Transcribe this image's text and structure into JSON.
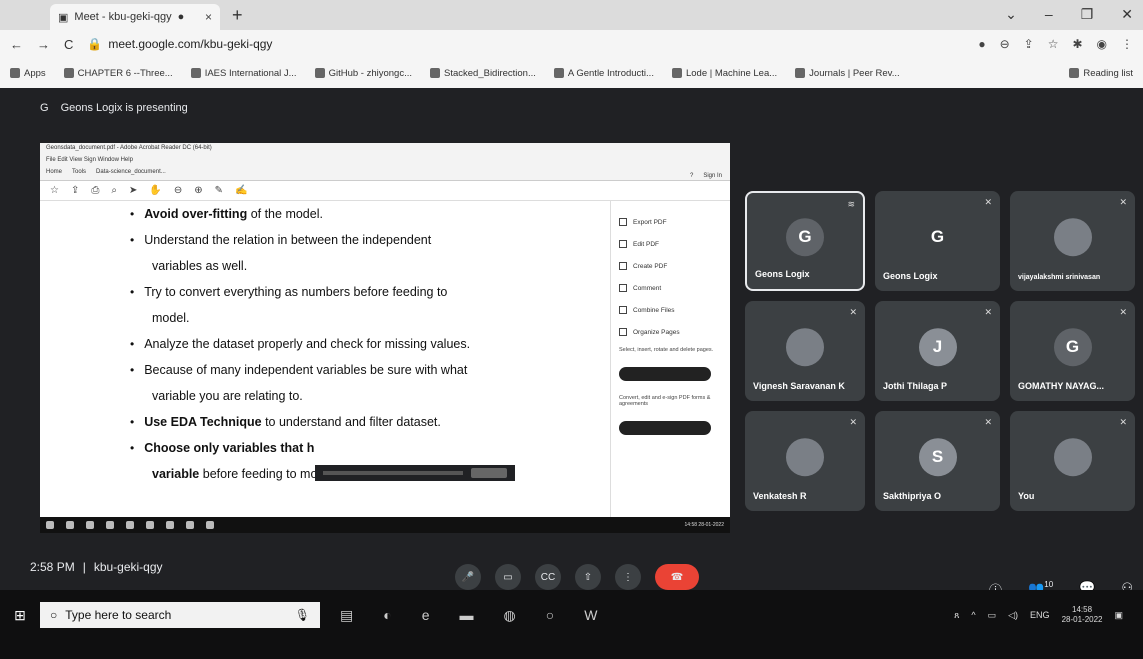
{
  "browser": {
    "tab_title": "Meet - kbu-geki-qgy",
    "tab_close": "×",
    "new_tab": "+",
    "back": "←",
    "forward": "→",
    "reload": "C",
    "url": "meet.google.com/kbu-geki-qgy",
    "window_controls": [
      "⌄",
      "–",
      "❐",
      "✕"
    ],
    "bookmarks": [
      "Apps",
      "CHAPTER 6 --Three...",
      "IAES International J...",
      "GitHub - zhiyongc...",
      "Stacked_Bidirection...",
      "A Gentle Introducti...",
      "Lode | Machine Lea...",
      "Journals | Peer Rev..."
    ],
    "reading_list": "Reading list"
  },
  "meet": {
    "presenter_initial": "G",
    "presenting_text": "Geons Logix is presenting",
    "meeting_time": "2:58 PM",
    "meeting_separator": "|",
    "meeting_code": "kbu-geki-qgy",
    "participants": [
      {
        "name": "Geons Logix",
        "initial": "G",
        "active": true
      },
      {
        "name": "Geons Logix",
        "initial": "G",
        "active": false
      },
      {
        "name": "vijayalakshmi srinivasan",
        "initial": "",
        "active": false
      },
      {
        "name": "Vignesh Saravanan K",
        "initial": "",
        "active": false
      },
      {
        "name": "Jothi Thilaga P",
        "initial": "J",
        "active": false
      },
      {
        "name": "GOMATHY NAYAG...",
        "initial": "G",
        "active": false
      },
      {
        "name": "Venkatesh R",
        "initial": "",
        "active": false
      },
      {
        "name": "Sakthipriya O",
        "initial": "S",
        "active": false
      },
      {
        "name": "You",
        "initial": "",
        "active": false
      }
    ],
    "participant_count": "10"
  },
  "shared_doc": {
    "acrobat_title": "Geonsdata_document.pdf - Adobe Acrobat Reader DC (64-bit)",
    "acrobat_menu": "File  Edit  View  Sign  Window  Help",
    "acrobat_tabs": [
      "Home",
      "Tools",
      "Data-science_document..."
    ],
    "sign_in": "Sign In",
    "bullets": [
      {
        "bold": "Avoid over-fitting",
        "rest": " of the model."
      },
      {
        "bold": "",
        "rest": "Understand the relation in between the independent",
        "cont": "variables as well."
      },
      {
        "bold": "",
        "rest": "Try to convert everything as numbers before feeding to",
        "cont": "model."
      },
      {
        "bold": "",
        "rest": "Analyze the dataset properly and check for missing values."
      },
      {
        "bold": "",
        "rest": "Because of many independent variables be sure with what",
        "cont": "variable you are relating to."
      },
      {
        "bold": "Use EDA Technique",
        "rest": " to understand and filter dataset."
      },
      {
        "bold": "Choose only variables that h",
        "rest": "",
        "cont_bold": "variable",
        "cont": " before feeding to model ."
      }
    ],
    "side_tools": [
      "Export PDF",
      "Edit PDF",
      "Create PDF",
      "Comment",
      "Combine Files",
      "Organize Pages"
    ],
    "side_promo_1": "Select, insert, rotate and delete pages.",
    "side_promo_2": "Convert, edit and e-sign PDF forms & agreements",
    "inner_clock": "14:58 28-01-2022"
  },
  "taskbar": {
    "start_icon": "⊞",
    "search_placeholder": "Type here to search",
    "lang": "ENG",
    "time": "14:58",
    "date": "28-01-2022"
  }
}
